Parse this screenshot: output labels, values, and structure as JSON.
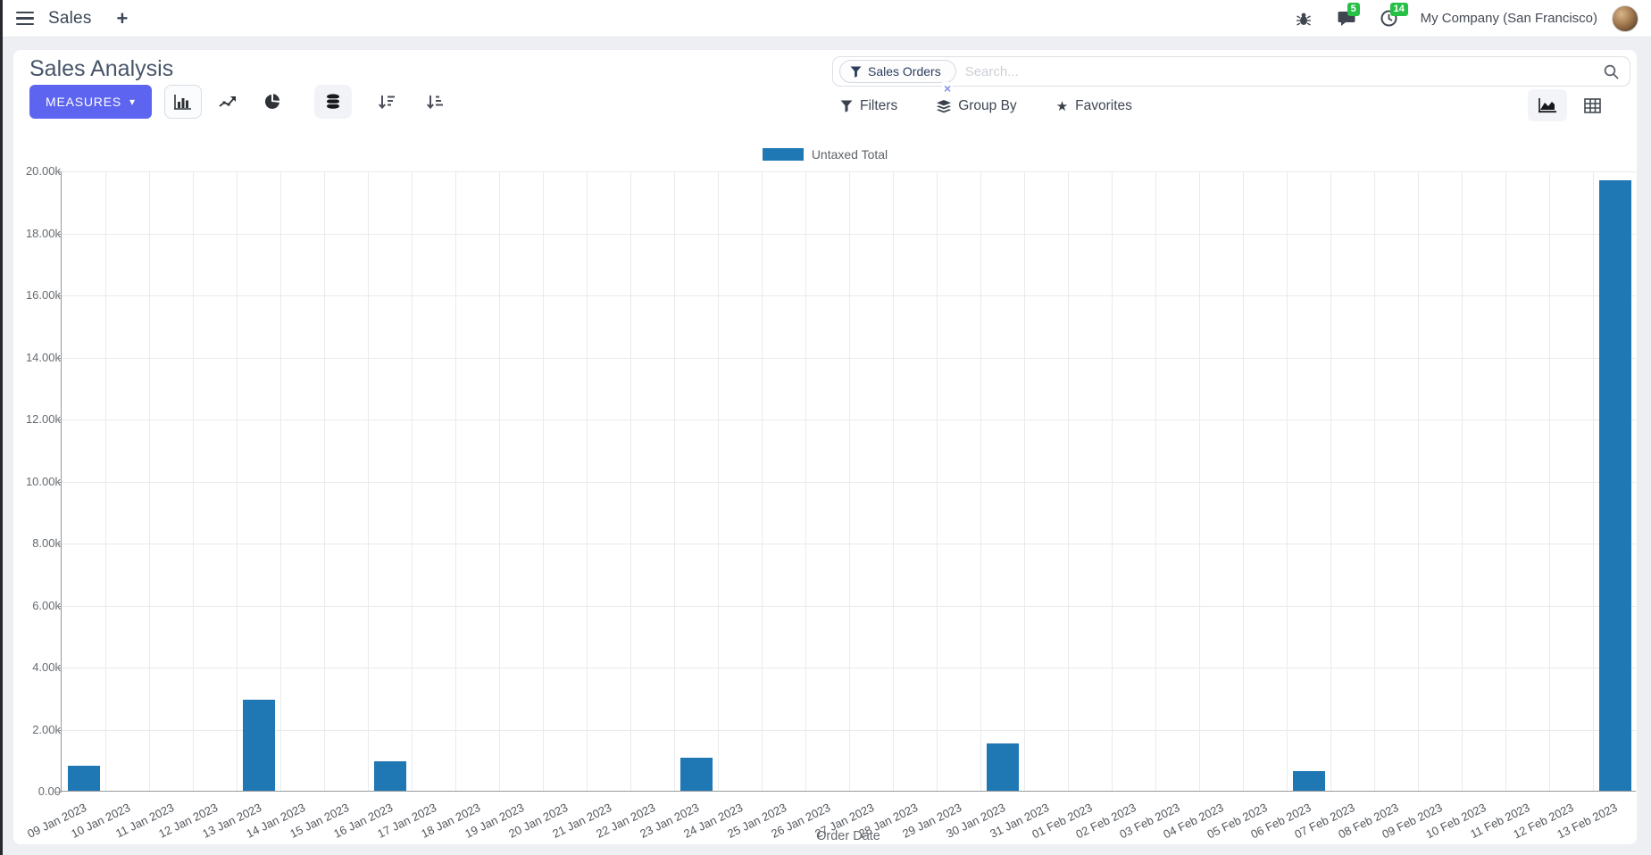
{
  "navbar": {
    "app_name": "Sales",
    "new_tab_label": "+",
    "message_count": "5",
    "activity_count": "14",
    "company": "My Company (San Francisco)"
  },
  "header": {
    "title": "Sales Analysis",
    "measures_label": "MEASURES",
    "caret": "▾"
  },
  "search": {
    "facet_label": "Sales Orders",
    "placeholder": "Search...",
    "remove_facet": "×"
  },
  "controls": {
    "filters": "Filters",
    "group_by": "Group By",
    "favorites": "Favorites",
    "star": "★"
  },
  "colors": {
    "bar": "#1f77b4",
    "accent": "#5c64f0",
    "badge": "#25c045"
  },
  "chart_data": {
    "type": "bar",
    "title": "",
    "legend": [
      "Untaxed Total"
    ],
    "legend_position": "top-center",
    "grid": true,
    "xlabel": "Order Date",
    "ylabel": "",
    "ylim": [
      0,
      20000
    ],
    "y_tick_step": 2000,
    "y_tick_labels": [
      "0.00",
      "2.00k",
      "4.00k",
      "6.00k",
      "8.00k",
      "10.00k",
      "12.00k",
      "14.00k",
      "16.00k",
      "18.00k",
      "20.00k"
    ],
    "categories": [
      "09 Jan 2023",
      "10 Jan 2023",
      "11 Jan 2023",
      "12 Jan 2023",
      "13 Jan 2023",
      "14 Jan 2023",
      "15 Jan 2023",
      "16 Jan 2023",
      "17 Jan 2023",
      "18 Jan 2023",
      "19 Jan 2023",
      "20 Jan 2023",
      "21 Jan 2023",
      "22 Jan 2023",
      "23 Jan 2023",
      "24 Jan 2023",
      "25 Jan 2023",
      "26 Jan 2023",
      "27 Jan 2023",
      "28 Jan 2023",
      "29 Jan 2023",
      "30 Jan 2023",
      "31 Jan 2023",
      "01 Feb 2023",
      "02 Feb 2023",
      "03 Feb 2023",
      "04 Feb 2023",
      "05 Feb 2023",
      "06 Feb 2023",
      "07 Feb 2023",
      "08 Feb 2023",
      "09 Feb 2023",
      "10 Feb 2023",
      "11 Feb 2023",
      "12 Feb 2023",
      "13 Feb 2023"
    ],
    "series": [
      {
        "name": "Untaxed Total",
        "color": "#1f77b4",
        "values": [
          800,
          0,
          0,
          0,
          2930,
          0,
          0,
          950,
          0,
          0,
          0,
          0,
          0,
          0,
          1060,
          0,
          0,
          0,
          0,
          0,
          0,
          1520,
          0,
          0,
          0,
          0,
          0,
          0,
          620,
          0,
          0,
          0,
          0,
          0,
          0,
          19690
        ]
      }
    ]
  }
}
